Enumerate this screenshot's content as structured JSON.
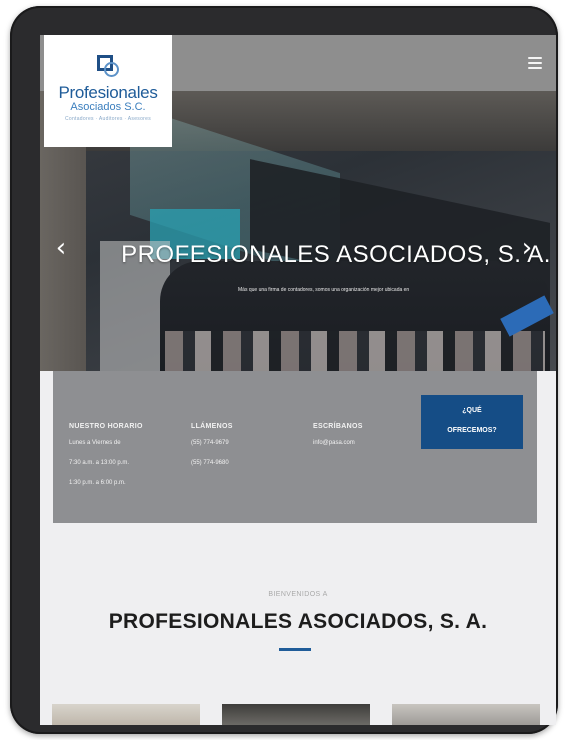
{
  "brand": {
    "logo_name": "Profesionales",
    "logo_sub": "Asociados S.C.",
    "logo_tagline": "Contadores · Auditores · Asesores"
  },
  "hero": {
    "title": "PROFESIONALES ASOCIADOS, S. A.",
    "subtitle": "Más que una firma de contadores, somos una organización mejor ubicada en",
    "prev_icon": "chevron-left-icon",
    "next_icon": "chevron-right-icon"
  },
  "info": {
    "hours": {
      "heading": "NUESTRO HORARIO",
      "lines": [
        "Lunes a Viernes de",
        "7:30 a.m. a 13:00 p.m.",
        "1:30 p.m. a 6:00 p.m."
      ]
    },
    "call": {
      "heading": "LLÁMENOS",
      "lines": [
        "(55) 774-9679",
        "(55) 774-9680"
      ]
    },
    "write": {
      "heading": "ESCRÍBANOS",
      "lines": [
        "info@pasa.com"
      ]
    },
    "cta_line1": "¿QUÉ",
    "cta_line2": "OFRECEMOS?"
  },
  "welcome": {
    "small": "BIENVENIDOS A",
    "title": "PROFESIONALES ASOCIADOS, S. A."
  },
  "colors": {
    "brand_blue": "#154d86",
    "band_gray": "#8e8f92",
    "topbar_gray": "#8e8e8e"
  }
}
